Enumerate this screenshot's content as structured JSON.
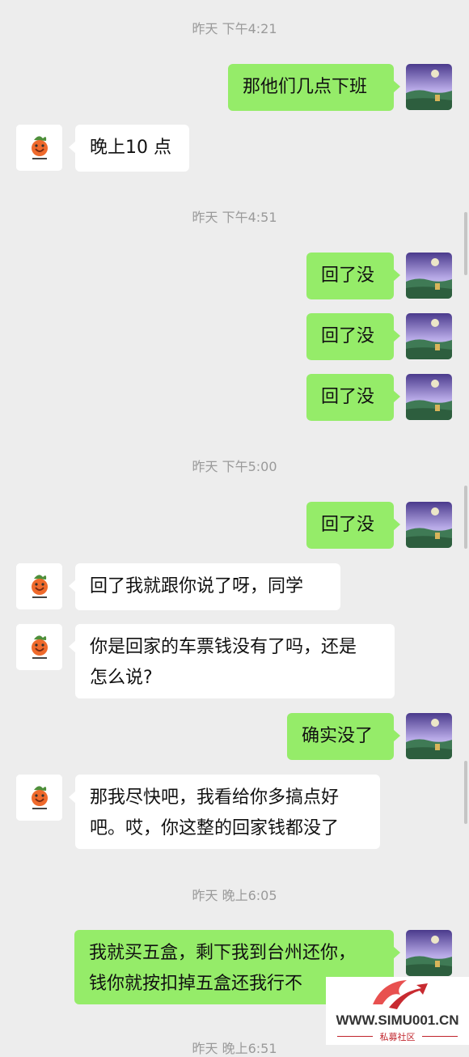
{
  "messages": [
    {
      "type": "time",
      "text": "昨天 下午4:21"
    },
    {
      "type": "me",
      "text": "那他们几点下班"
    },
    {
      "type": "them",
      "text": "晚上10 点"
    },
    {
      "type": "time",
      "text": "昨天 下午4:51"
    },
    {
      "type": "me",
      "text": "回了没"
    },
    {
      "type": "me",
      "text": "回了没"
    },
    {
      "type": "me",
      "text": "回了没"
    },
    {
      "type": "time",
      "text": "昨天 下午5:00"
    },
    {
      "type": "me",
      "text": "回了没"
    },
    {
      "type": "them",
      "text": "回了我就跟你说了呀，同学"
    },
    {
      "type": "them",
      "lines": [
        "你是回家的车票钱没有了吗，还是",
        "怎么说?"
      ]
    },
    {
      "type": "me",
      "text": "确实没了"
    },
    {
      "type": "them",
      "lines": [
        "那我尽快吧，我看给你多搞点好",
        "吧。哎，你这整的回家钱都没了"
      ]
    },
    {
      "type": "time",
      "text": "昨天 晚上6:05"
    },
    {
      "type": "me",
      "lines": [
        "我就买五盒，剩下我到台州还你，",
        "钱你就按扣掉五盒还我行不"
      ]
    },
    {
      "type": "time",
      "text": "昨天 晚上6:51"
    }
  ],
  "watermark": {
    "site": "WWW.SIMU001.CN",
    "label": "私募社区"
  },
  "colors": {
    "me_bubble": "#95ec69",
    "them_bubble": "#ffffff",
    "background": "#ededed"
  }
}
